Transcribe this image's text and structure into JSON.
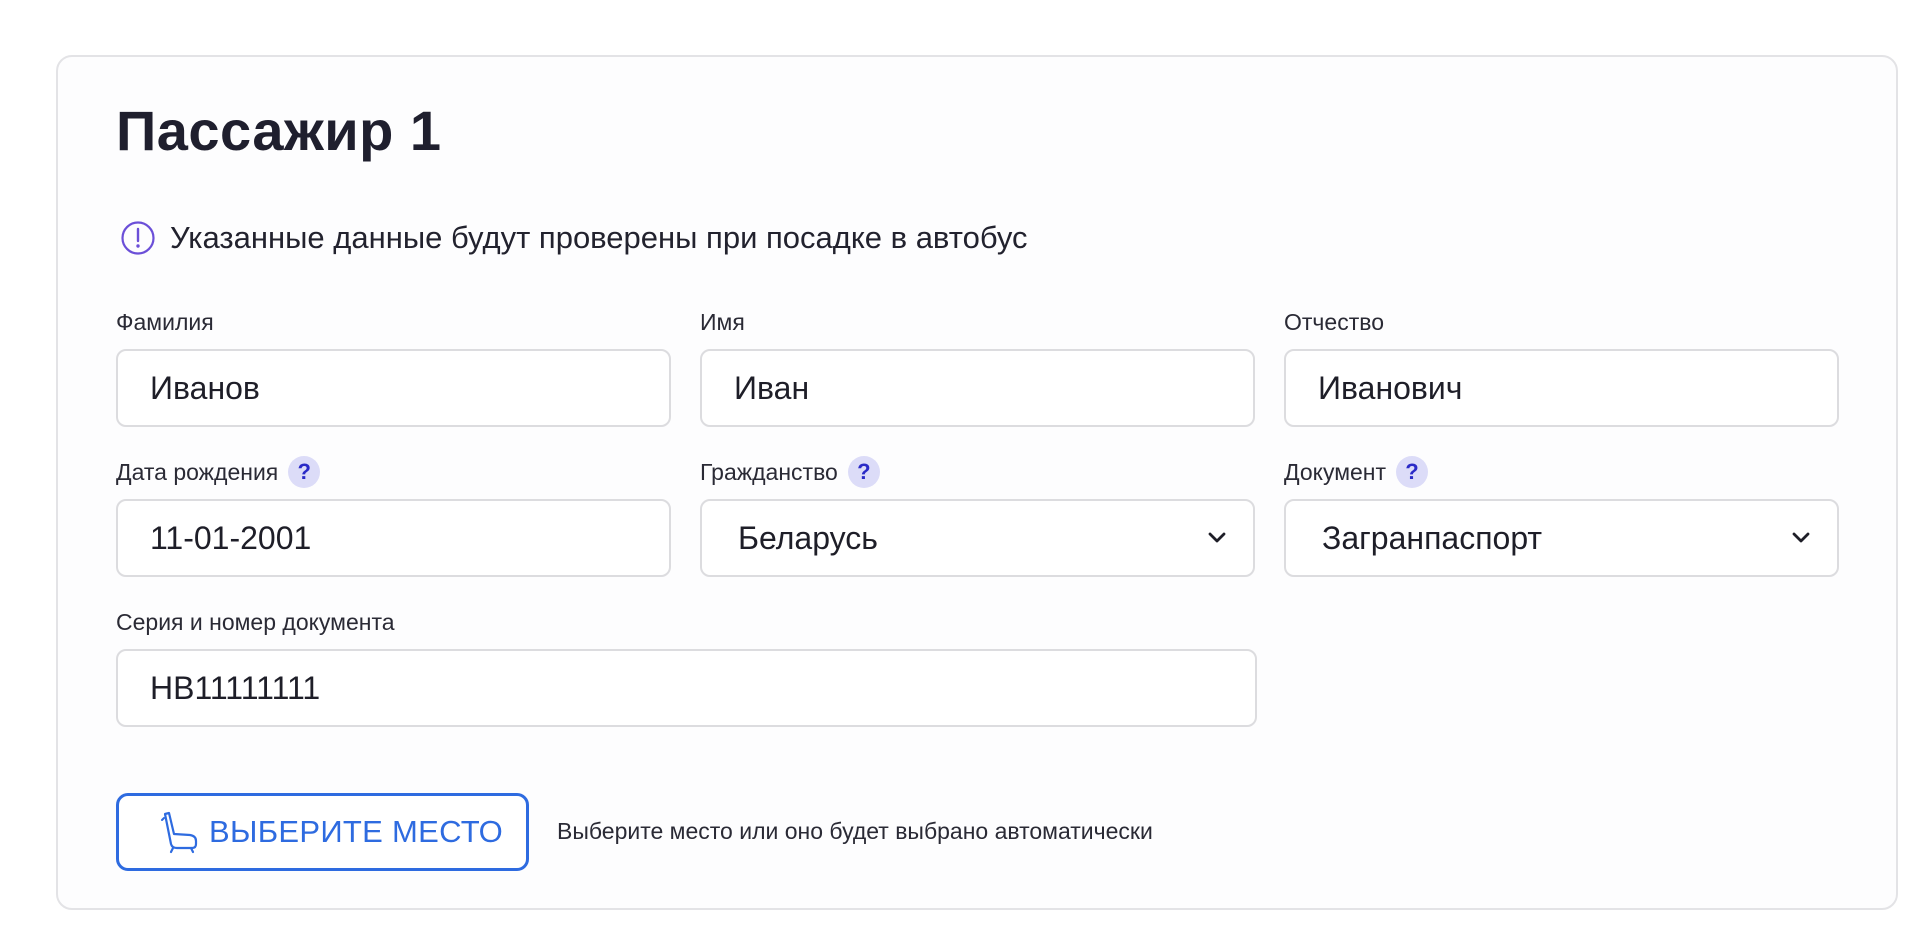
{
  "passenger": {
    "title": "Пассажир 1",
    "notice": "Указанные данные будут проверены при посадке в автобус"
  },
  "fields": {
    "last_name": {
      "label": "Фамилия",
      "value": "Иванов"
    },
    "first_name": {
      "label": "Имя",
      "value": "Иван"
    },
    "middle_name": {
      "label": "Отчество",
      "value": "Иванович"
    },
    "birth_date": {
      "label": "Дата рождения",
      "value": "11-01-2001",
      "help": "?"
    },
    "citizenship": {
      "label": "Гражданство",
      "value": "Беларусь",
      "help": "?"
    },
    "document": {
      "label": "Документ",
      "value": "Загранпаспорт",
      "help": "?"
    },
    "document_number": {
      "label": "Серия и номер документа",
      "value": "НВ11111111"
    }
  },
  "seat": {
    "button_label": "ВЫБЕРИТЕ МЕСТО",
    "hint": "Выберите место или оно будет выбрано автоматически"
  },
  "icons": {
    "notice": "info-circle-icon",
    "help": "question-icon",
    "dropdown": "chevron-down-icon",
    "seat": "seat-icon"
  },
  "colors": {
    "accent": "#2e6be0",
    "notice_icon": "#6b4fd8",
    "help_bg": "#dcdcf8",
    "help_fg": "#2b2bc7"
  }
}
